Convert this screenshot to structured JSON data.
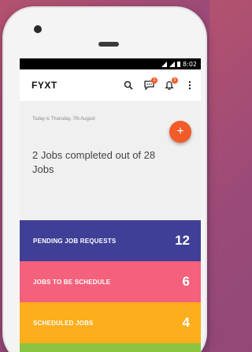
{
  "status_bar": {
    "time": "8:02"
  },
  "app_bar": {
    "title": "FYXT",
    "messages_badge": "3",
    "notifications_badge": "9"
  },
  "summary": {
    "date_text": "Today is Thursday, 7th August",
    "jobs_completed": "2 Jobs completed out of 28 Jobs",
    "fab_label": "+"
  },
  "job_rows": [
    {
      "label": "PENDING JOB REQUESTS",
      "count": "12",
      "color": "#3f3f97"
    },
    {
      "label": "JOBS TO BE SCHEDULE",
      "count": "6",
      "color": "#f4617c"
    },
    {
      "label": "SCHEDULED JOBS",
      "count": "4",
      "color": "#fcae1c"
    },
    {
      "label": "",
      "count": "",
      "color": "#8bc53f"
    }
  ]
}
